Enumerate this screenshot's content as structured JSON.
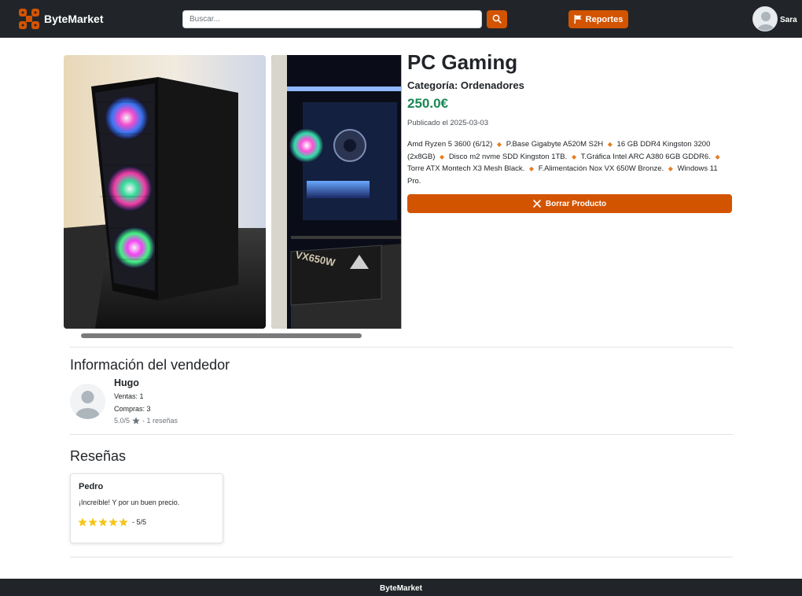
{
  "header": {
    "brand": "ByteMarket",
    "search_placeholder": "Buscar...",
    "reports_label": "Reportes",
    "user_name": "Sara",
    "accent_color": "#d35400"
  },
  "product": {
    "title": "PC Gaming",
    "category": "Categoría: Ordenadores",
    "price": "250.0€",
    "published": "Publicado el 2025-03-03",
    "description_items": [
      "Amd Ryzen 5 3600 (6/12)",
      "P.Base Gigabyte A520M S2H",
      "16 GB DDR4 Kingston 3200 (2x8GB)",
      "Disco m2 nvme SDD Kingston 1TB.",
      "T.Gráfica Intel ARC A380 6GB GDDR6.",
      "Torre ATX Montech X3 Mesh Black.",
      "F.Alimentación Nox VX 650W Bronze.",
      "Windows 11 Pro."
    ],
    "delete_label": "Borrar Producto",
    "psu_label": "VX650W"
  },
  "seller": {
    "heading": "Información del vendedor",
    "name": "Hugo",
    "sales": "Ventas: 1",
    "purchases": "Compras: 3",
    "rating": "5.0/5",
    "review_count": "- 1 reseñas"
  },
  "reviews": {
    "heading": "Reseñas",
    "items": [
      {
        "author": "Pedro",
        "text": "¡Increíble! Y por un buen precio.",
        "stars": 5,
        "score": "- 5/5"
      }
    ]
  },
  "footer": {
    "text": "ByteMarket"
  }
}
